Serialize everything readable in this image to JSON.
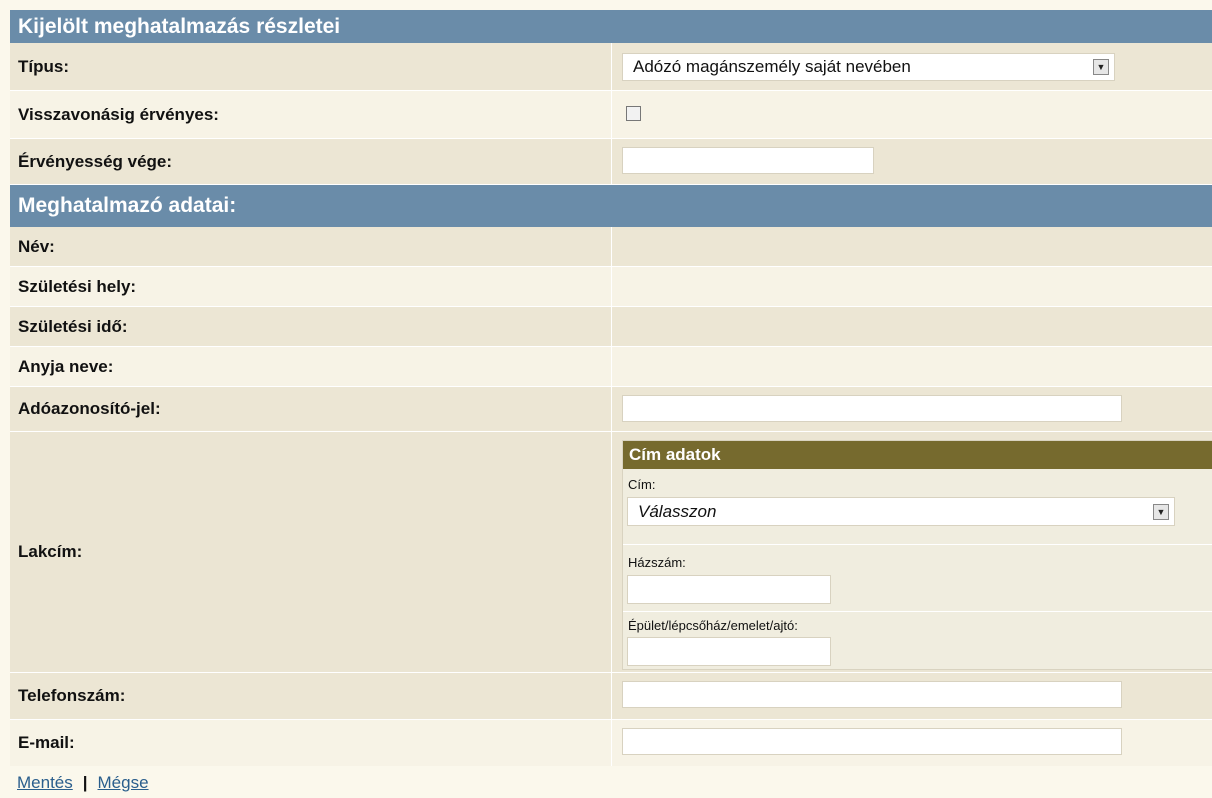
{
  "details": {
    "header": "Kijelölt meghatalmazás részletei",
    "type_label": "Típus:",
    "type_value": "Adózó magánszemély saját nevében",
    "until_revoked_label": "Visszavonásig érvényes:",
    "until_revoked_checked": false,
    "validity_end_label": "Érvényesség vége:",
    "validity_end_value": ""
  },
  "grantor": {
    "header": "Meghatalmazó adatai:",
    "name_label": "Név:",
    "birthplace_label": "Születési hely:",
    "birthdate_label": "Születési idő:",
    "mother_name_label": "Anyja neve:",
    "tax_id_label": "Adóazonosító-jel:",
    "tax_id_value": "",
    "address_label": "Lakcím:",
    "address": {
      "header": "Cím adatok",
      "address_label": "Cím:",
      "address_value": "Válasszon",
      "house_number_label": "Házszám:",
      "house_number_value": "",
      "building_label": "Épület/lépcsőház/emelet/ajtó:",
      "building_value": ""
    },
    "phone_label": "Telefonszám:",
    "phone_value": "",
    "email_label": "E-mail:",
    "email_value": ""
  },
  "actions": {
    "save": "Mentés",
    "separator": "|",
    "cancel": "Mégse"
  },
  "icons": {
    "dropdown": "chevron-down-icon"
  }
}
